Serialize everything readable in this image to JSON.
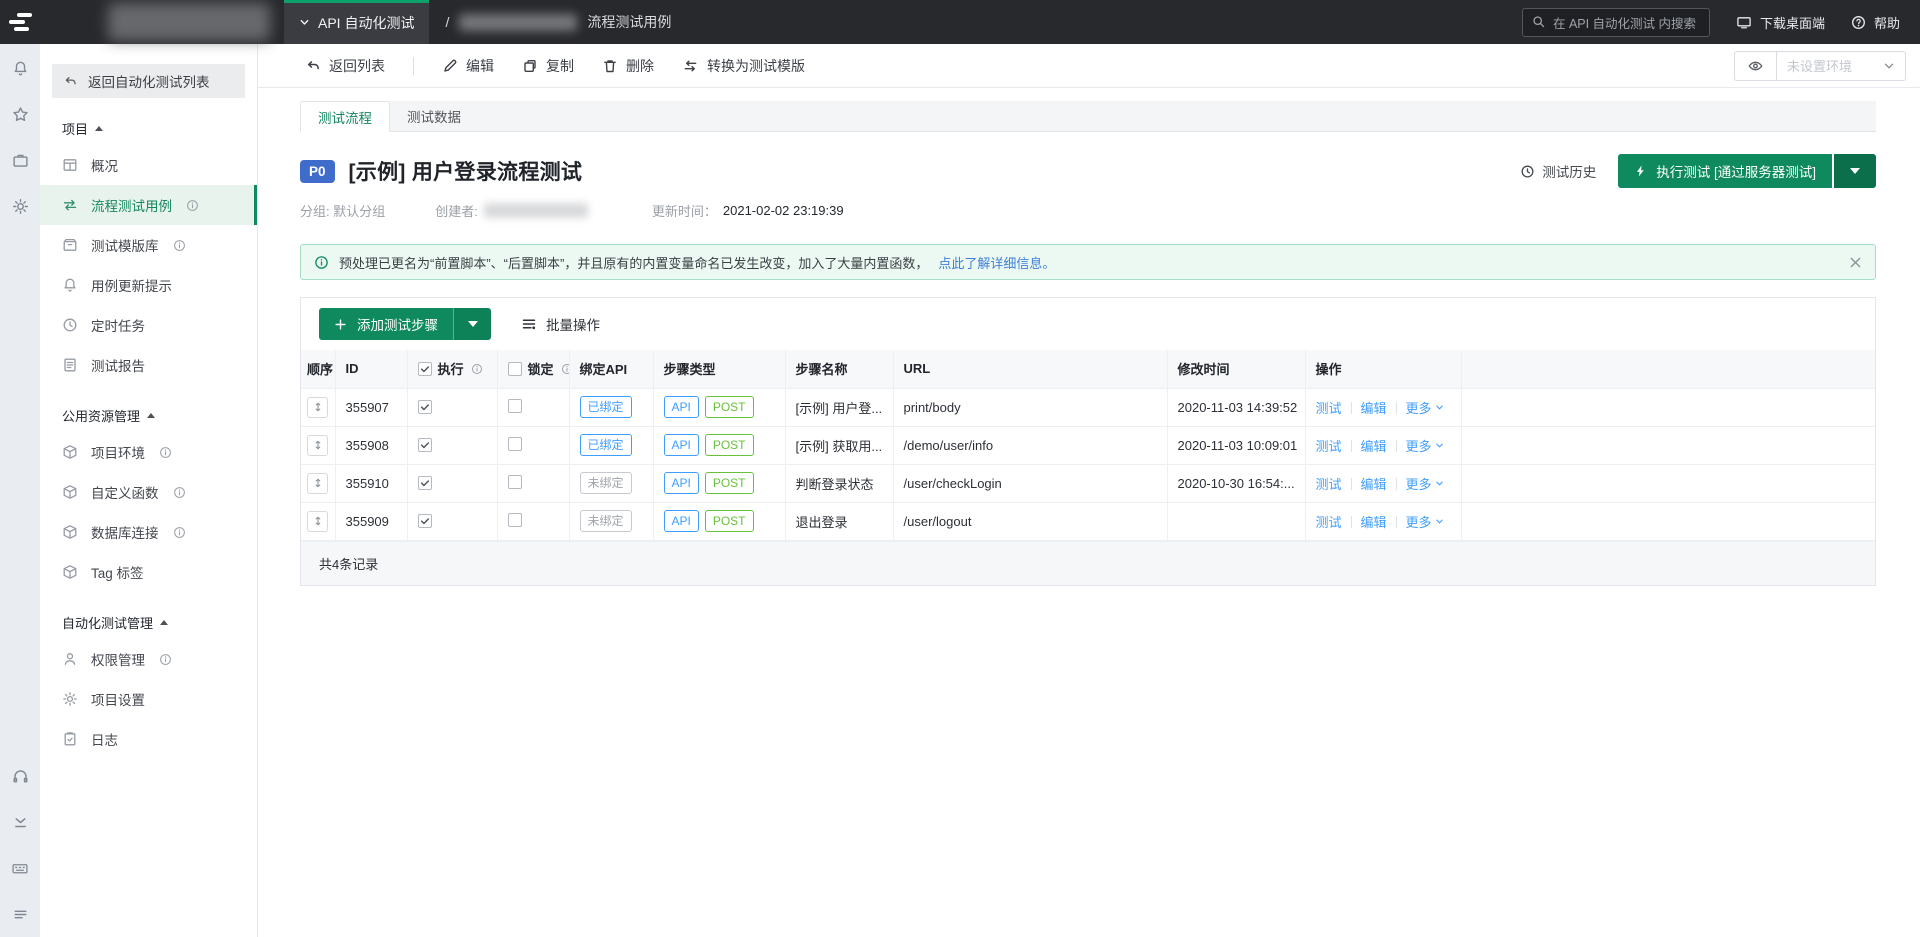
{
  "colors": {
    "accent_green": "#0e8a5e",
    "link_blue": "#409eff",
    "badge_blue": "#3f6bca",
    "method_green": "#67c23a"
  },
  "topbar": {
    "menu_label": "API 自动化测试",
    "breadcrumb_sep": "/",
    "breadcrumb_current": "流程测试用例",
    "search_placeholder": "在 API 自动化测试 内搜索",
    "download_label": "下载桌面端",
    "help_label": "帮助"
  },
  "sidebar": {
    "back_label": "返回自动化测试列表",
    "sections": [
      {
        "title": "项目",
        "items": [
          {
            "label": "概况"
          },
          {
            "label": "流程测试用例"
          },
          {
            "label": "测试模版库"
          },
          {
            "label": "用例更新提示"
          },
          {
            "label": "定时任务"
          },
          {
            "label": "测试报告"
          }
        ]
      },
      {
        "title": "公用资源管理",
        "items": [
          {
            "label": "项目环境"
          },
          {
            "label": "自定义函数"
          },
          {
            "label": "数据库连接"
          },
          {
            "label": "Tag 标签"
          }
        ]
      },
      {
        "title": "自动化测试管理",
        "items": [
          {
            "label": "权限管理"
          },
          {
            "label": "项目设置"
          },
          {
            "label": "日志"
          }
        ]
      }
    ]
  },
  "toolbar": {
    "back": "返回列表",
    "edit": "编辑",
    "copy": "复制",
    "delete": "删除",
    "convert": "转换为测试模版",
    "env_placeholder": "未设置环境"
  },
  "tabs": {
    "flow": "测试流程",
    "data": "测试数据"
  },
  "detail": {
    "priority": "P0",
    "title": "[示例] 用户登录流程测试",
    "group_label": "分组: 默认分组",
    "creator_label": "创建者:",
    "updated_label": "更新时间：",
    "updated_value": "2021-02-02 23:19:39",
    "history": "测试历史",
    "run_button": "执行测试 [通过服务器测试]"
  },
  "alert": {
    "text": "预处理已更名为“前置脚本”、“后置脚本”，并且原有的内置变量命名已发生改变，加入了大量内置函数，",
    "link": "点此了解详细信息。"
  },
  "steps": {
    "add_button": "添加测试步骤",
    "batch": "批量操作",
    "columns": {
      "order": "顺序",
      "id": "ID",
      "exec": "执行",
      "lock": "锁定",
      "bind": "绑定API",
      "type": "步骤类型",
      "name": "步骤名称",
      "url": "URL",
      "time": "修改时间",
      "ops": "操作"
    },
    "rows": [
      {
        "id": "355907",
        "bind": "已绑定",
        "api": "API",
        "method": "POST",
        "name": "[示例] 用户登...",
        "url": "print/body",
        "time": "2020-11-03 14:39:52"
      },
      {
        "id": "355908",
        "bind": "已绑定",
        "api": "API",
        "method": "POST",
        "name": "[示例] 获取用...",
        "url": "/demo/user/info",
        "time": "2020-11-03 10:09:01"
      },
      {
        "id": "355910",
        "bind": "未绑定",
        "api": "API",
        "method": "POST",
        "name": "判断登录状态",
        "url": "/user/checkLogin",
        "time": "2020-10-30 16:54:..."
      },
      {
        "id": "355909",
        "bind": "未绑定",
        "api": "API",
        "method": "POST",
        "name": "退出登录",
        "url": "/user/logout",
        "time": ""
      }
    ],
    "ops": {
      "test": "测试",
      "edit": "编辑",
      "more": "更多"
    },
    "footer": "共4条记录"
  }
}
